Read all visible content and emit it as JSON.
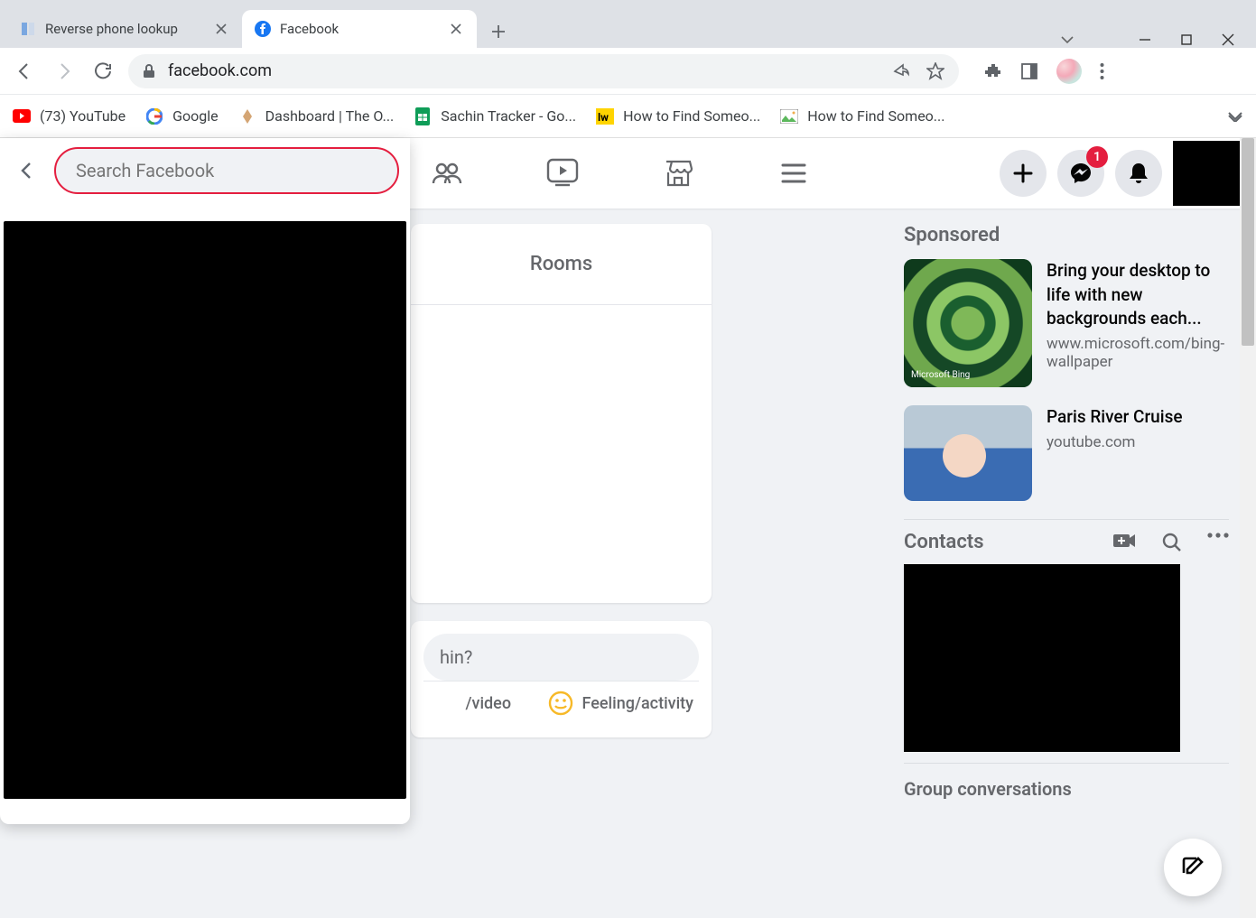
{
  "window": {
    "tabs": [
      {
        "title": "Reverse phone lookup",
        "active": false
      },
      {
        "title": "Facebook",
        "active": true
      }
    ]
  },
  "address": {
    "url": "facebook.com"
  },
  "bookmarks": [
    {
      "label": "(73) YouTube",
      "icon": "youtube"
    },
    {
      "label": "Google",
      "icon": "google"
    },
    {
      "label": "Dashboard | The O...",
      "icon": "odin"
    },
    {
      "label": "Sachin Tracker - Go...",
      "icon": "sheets"
    },
    {
      "label": "How to Find Someo...",
      "icon": "lw"
    },
    {
      "label": "How to Find Someo...",
      "icon": "pic"
    }
  ],
  "fb": {
    "search_placeholder": "Search Facebook",
    "messenger_badge": "1",
    "feed": {
      "rooms_tab": "Rooms",
      "composer_prompt": "hin?",
      "action_video": "/video",
      "action_feeling": "Feeling/activity"
    },
    "sponsored": {
      "heading": "Sponsored",
      "items": [
        {
          "title": "Bring your desktop to life with new backgrounds each...",
          "link": "www.microsoft.com/bing-wallpaper",
          "bing_label": "Microsoft Bing"
        },
        {
          "title": "Paris River Cruise",
          "link": "youtube.com"
        }
      ]
    },
    "contacts_heading": "Contacts",
    "group_heading": "Group conversations"
  }
}
